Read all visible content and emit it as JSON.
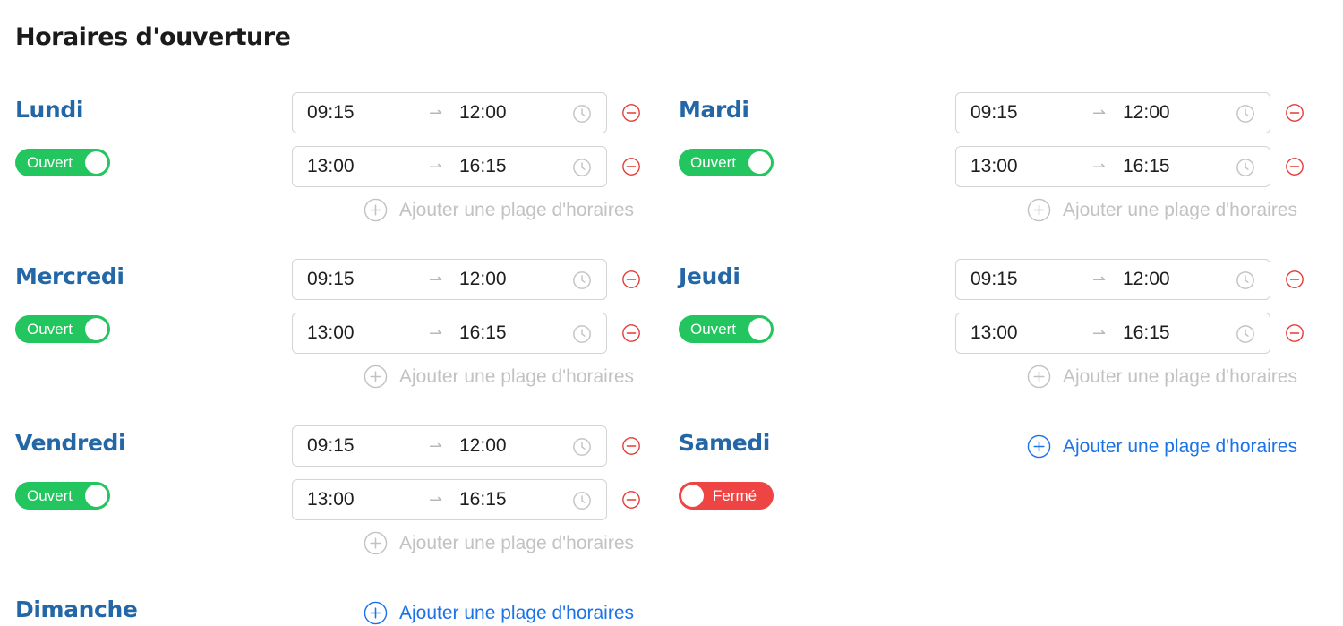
{
  "page_title": "Horaires d'ouverture",
  "add_range_label": "Ajouter une plage d'horaires",
  "arrow_symbol": "⇀",
  "colors": {
    "day_name": "#2367a7",
    "open_toggle": "#22c55e",
    "closed_toggle": "#ef4444",
    "add_active": "#1a73e8",
    "add_muted": "#c2c2c2",
    "remove_icon": "#e53935"
  },
  "days": {
    "lundi": {
      "name": "Lundi",
      "status": "Ouvert",
      "open": true,
      "slots": [
        {
          "start": "09:15",
          "end": "12:00"
        },
        {
          "start": "13:00",
          "end": "16:15"
        }
      ]
    },
    "mardi": {
      "name": "Mardi",
      "status": "Ouvert",
      "open": true,
      "slots": [
        {
          "start": "09:15",
          "end": "12:00"
        },
        {
          "start": "13:00",
          "end": "16:15"
        }
      ]
    },
    "mercredi": {
      "name": "Mercredi",
      "status": "Ouvert",
      "open": true,
      "slots": [
        {
          "start": "09:15",
          "end": "12:00"
        },
        {
          "start": "13:00",
          "end": "16:15"
        }
      ]
    },
    "jeudi": {
      "name": "Jeudi",
      "status": "Ouvert",
      "open": true,
      "slots": [
        {
          "start": "09:15",
          "end": "12:00"
        },
        {
          "start": "13:00",
          "end": "16:15"
        }
      ]
    },
    "vendredi": {
      "name": "Vendredi",
      "status": "Ouvert",
      "open": true,
      "slots": [
        {
          "start": "09:15",
          "end": "12:00"
        },
        {
          "start": "13:00",
          "end": "16:15"
        }
      ]
    },
    "samedi": {
      "name": "Samedi",
      "status": "Fermé",
      "open": false,
      "slots": []
    },
    "dimanche": {
      "name": "Dimanche",
      "open": false,
      "slots": []
    }
  }
}
